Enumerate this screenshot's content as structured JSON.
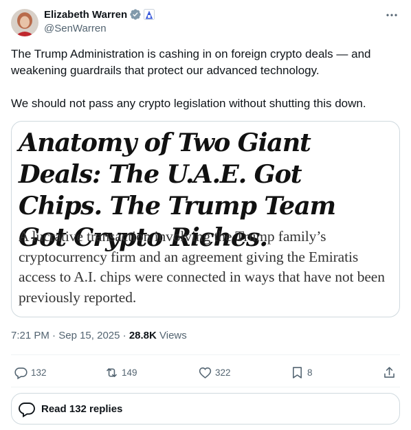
{
  "author": {
    "display_name": "Elizabeth Warren",
    "handle": "@SenWarren",
    "verified_badge_icon": "verified-badge-icon",
    "affiliation_icon": "us-government-affiliation-icon",
    "verified_color": "#829aab"
  },
  "tweet": {
    "paragraphs": [
      "The Trump Administration is cashing in on foreign crypto deals — and weakening guardrails that protect our advanced technology.",
      "We should not pass any crypto legislation without shutting this down."
    ]
  },
  "card": {
    "headline": "Anatomy of Two Giant Deals: The U.A.E. Got Chips. The Trump Team Got Crypto Riches.",
    "dek": "A lucrative transaction involving the Trump family’s cryptocurrency firm and an agreement giving the Emiratis access to A.I. chips were connected in ways that have not been previously reported."
  },
  "meta": {
    "time": "7:21 PM",
    "separator": " · ",
    "date": "Sep 15, 2025",
    "views_count": "28.8K",
    "views_label": " Views"
  },
  "actions": {
    "replies": "132",
    "reposts": "149",
    "likes": "322",
    "bookmarks": "8"
  },
  "read_replies": {
    "label": "Read 132 replies"
  },
  "colors": {
    "text_primary": "#0f1419",
    "text_secondary": "#536471",
    "border": "#cfd9de",
    "divider": "#eff3f4"
  }
}
